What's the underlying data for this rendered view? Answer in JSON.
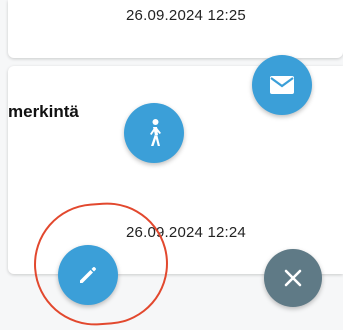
{
  "entries": [
    {
      "timestamp": "26.09.2024 12:25"
    },
    {
      "text": "merkintä",
      "timestamp": "26.09.2024 12:24"
    }
  ],
  "fabs": {
    "mail": {
      "icon": "mail-icon",
      "color": "#3b9fd8"
    },
    "walk": {
      "icon": "walking-person-icon",
      "color": "#3b9fd8"
    },
    "edit": {
      "icon": "pencil-icon",
      "color": "#3b9fd8"
    },
    "close": {
      "icon": "close-icon",
      "color": "#5f7a86"
    }
  },
  "annotation": {
    "highlight_color": "#e2482e"
  }
}
